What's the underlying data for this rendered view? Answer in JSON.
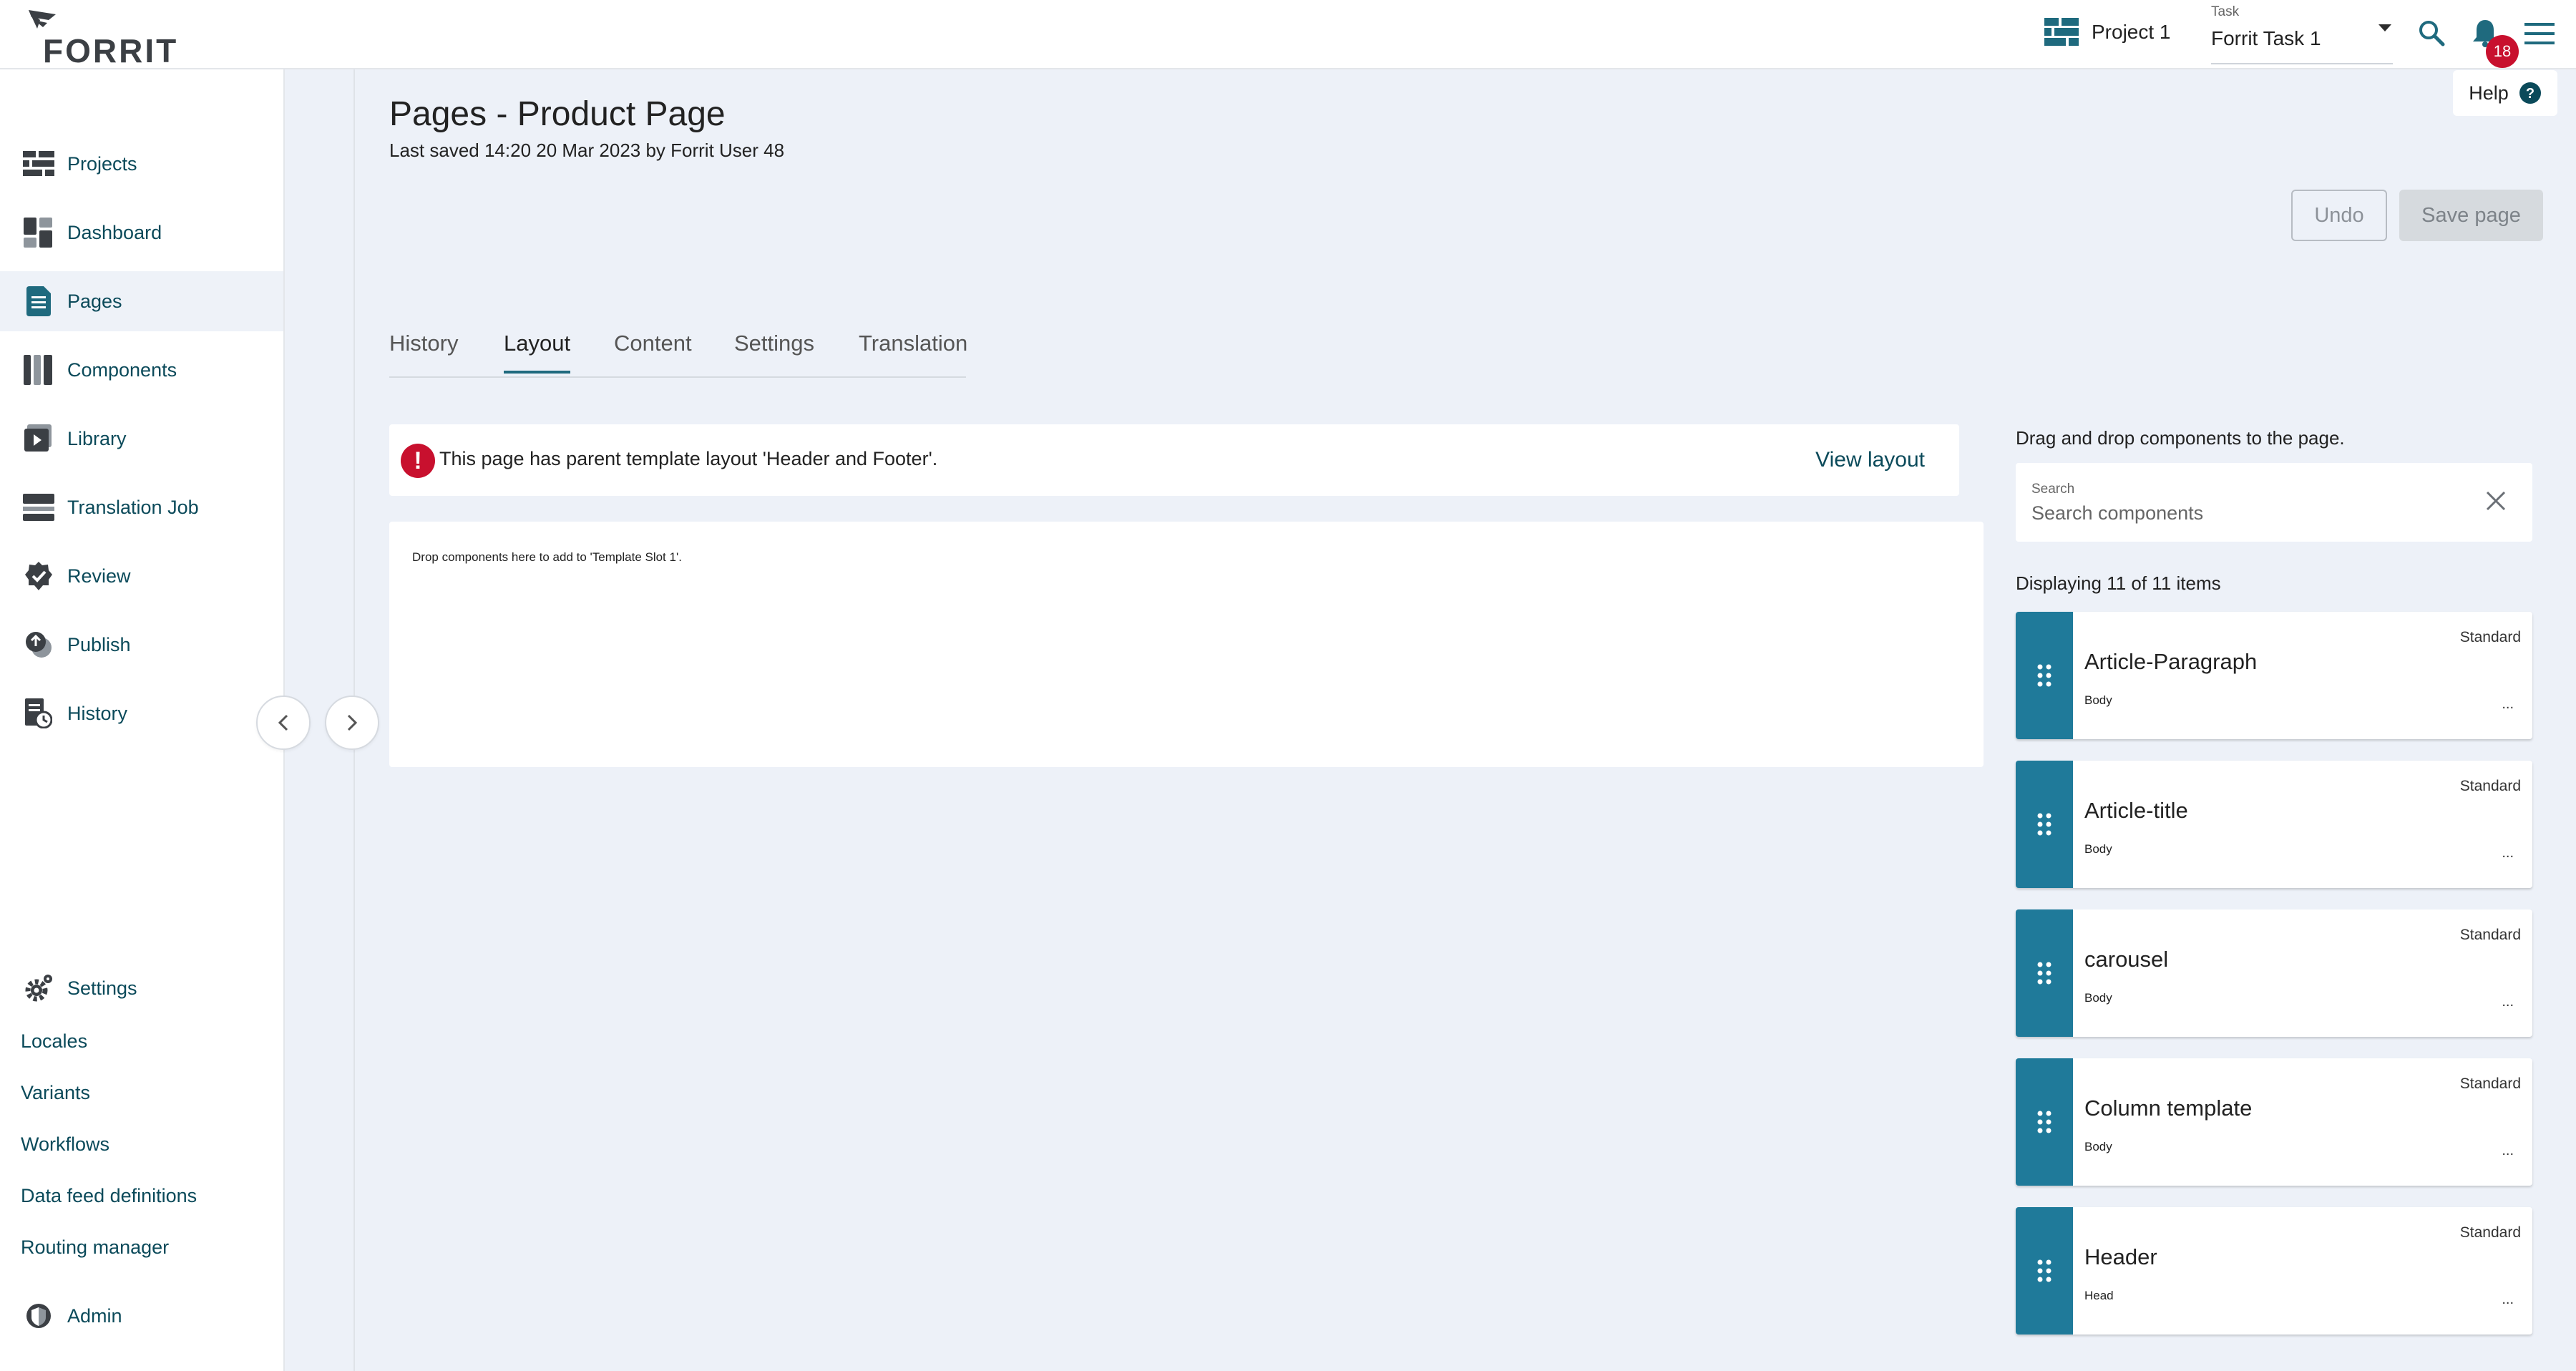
{
  "app": {
    "logo_text": "FORRIT"
  },
  "topbar": {
    "project_label": "Project 1",
    "task_label": "Task",
    "task_value": "Forrit Task 1",
    "notification_count": "18"
  },
  "sidebar": {
    "items": [
      {
        "label": "Projects",
        "icon": "projects-icon"
      },
      {
        "label": "Dashboard",
        "icon": "dashboard-icon"
      },
      {
        "label": "Pages",
        "icon": "pages-icon",
        "active": true
      },
      {
        "label": "Components",
        "icon": "components-icon"
      },
      {
        "label": "Library",
        "icon": "library-icon"
      },
      {
        "label": "Translation Job",
        "icon": "translation-job-icon"
      },
      {
        "label": "Review",
        "icon": "review-icon"
      },
      {
        "label": "Publish",
        "icon": "publish-icon"
      },
      {
        "label": "History",
        "icon": "history-icon"
      }
    ],
    "settings": {
      "label": "Settings",
      "links": [
        "Locales",
        "Variants",
        "Workflows",
        "Data feed definitions",
        "Routing manager"
      ]
    },
    "admin": {
      "label": "Admin"
    }
  },
  "page": {
    "title": "Pages - Product Page",
    "last_saved": "Last saved 14:20 20 Mar 2023 by Forrit User 48",
    "help_label": "Help",
    "undo_label": "Undo",
    "save_label": "Save page"
  },
  "tabs": [
    {
      "label": "History"
    },
    {
      "label": "Layout",
      "active": true
    },
    {
      "label": "Content"
    },
    {
      "label": "Settings"
    },
    {
      "label": "Translation"
    }
  ],
  "alert": {
    "message": "This page has parent template layout 'Header and Footer'.",
    "action": "View layout"
  },
  "dropzone": {
    "text": "Drop components here to add to 'Template Slot 1'."
  },
  "components_panel": {
    "hint": "Drag and drop components to the page.",
    "search_label": "Search",
    "search_placeholder": "Search components",
    "count_text": "Displaying 11 of 11 items",
    "items": [
      {
        "name": "Article-Paragraph",
        "type": "Standard",
        "category": "Body"
      },
      {
        "name": "Article-title",
        "type": "Standard",
        "category": "Body"
      },
      {
        "name": "carousel",
        "type": "Standard",
        "category": "Body"
      },
      {
        "name": "Column template",
        "type": "Standard",
        "category": "Body"
      },
      {
        "name": "Header",
        "type": "Standard",
        "category": "Head"
      }
    ],
    "more_symbol": "..."
  },
  "colors": {
    "accent": "#1f7a9a",
    "nav_text": "#0b4a5a",
    "alert_red": "#c8102e",
    "background": "#edf1f8"
  }
}
